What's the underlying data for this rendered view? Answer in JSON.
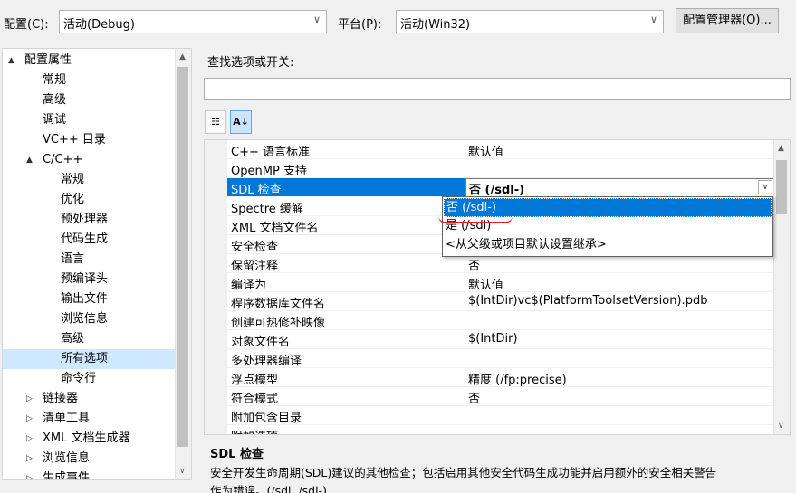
{
  "toolbar": {
    "config_label": "配置(C):",
    "config_value": "活动(Debug)",
    "platform_label": "平台(P):",
    "platform_value": "活动(Win32)",
    "config_manager_button": "配置管理器(O)..."
  },
  "tree": {
    "items": [
      {
        "label": "配置属性",
        "expander": "▲",
        "level": 0
      },
      {
        "label": "常规",
        "level": 1
      },
      {
        "label": "高级",
        "level": 1
      },
      {
        "label": "调试",
        "level": 1
      },
      {
        "label": "VC++ 目录",
        "level": 1
      },
      {
        "label": "C/C++",
        "expander": "▲",
        "level": 1
      },
      {
        "label": "常规",
        "level": 2
      },
      {
        "label": "优化",
        "level": 2
      },
      {
        "label": "预处理器",
        "level": 2
      },
      {
        "label": "代码生成",
        "level": 2
      },
      {
        "label": "语言",
        "level": 2
      },
      {
        "label": "预编译头",
        "level": 2
      },
      {
        "label": "输出文件",
        "level": 2
      },
      {
        "label": "浏览信息",
        "level": 2
      },
      {
        "label": "高级",
        "level": 2
      },
      {
        "label": "所有选项",
        "level": 2,
        "selected": true
      },
      {
        "label": "命令行",
        "level": 2
      },
      {
        "label": "链接器",
        "expander": "▷",
        "level": 1
      },
      {
        "label": "清单工具",
        "expander": "▷",
        "level": 1
      },
      {
        "label": "XML 文档生成器",
        "expander": "▷",
        "level": 1
      },
      {
        "label": "浏览信息",
        "expander": "▷",
        "level": 1
      },
      {
        "label": "生成事件",
        "expander": "▷",
        "level": 1
      }
    ]
  },
  "search": {
    "label": "查找选项或开关:",
    "value": ""
  },
  "tools": {
    "categorized_icon": "categorized-icon",
    "alphabetical_icon": "sort-az-icon"
  },
  "properties": [
    {
      "name": "C++ 语言标准",
      "value": "默认值"
    },
    {
      "name": "OpenMP 支持",
      "value": ""
    },
    {
      "name": "SDL 检查",
      "value": "否 (/sdl-)",
      "selected": true
    },
    {
      "name": "Spectre 缓解",
      "value": ""
    },
    {
      "name": "XML 文档文件名",
      "value": ""
    },
    {
      "name": "安全检查",
      "value": ""
    },
    {
      "name": "保留注释",
      "value": "否"
    },
    {
      "name": "编译为",
      "value": "默认值"
    },
    {
      "name": "程序数据库文件名",
      "value": "$(IntDir)vc$(PlatformToolsetVersion).pdb"
    },
    {
      "name": "创建可热修补映像",
      "value": ""
    },
    {
      "name": "对象文件名",
      "value": "$(IntDir)"
    },
    {
      "name": "多处理器编译",
      "value": ""
    },
    {
      "name": "浮点模型",
      "value": "精度 (/fp:precise)"
    },
    {
      "name": "符合模式",
      "value": "否"
    },
    {
      "name": "附加包含目录",
      "value": ""
    },
    {
      "name": "附加选项",
      "value": ""
    }
  ],
  "dropdown": {
    "options": [
      "否 (/sdl-)",
      "是 (/sdl)",
      "<从父级或项目默认设置继承>"
    ],
    "highlighted": 0
  },
  "description": {
    "title": "SDL 检查",
    "body": "安全开发生命周期(SDL)建议的其他检查；包括启用其他安全代码生成功能并启用额外的安全相关警告",
    "body2": "作为错误。(/sdl, /sdl-)"
  },
  "colors": {
    "selection": "#0078d7",
    "tree_selection": "#cde8ff",
    "annotation_red": "#e02020"
  }
}
